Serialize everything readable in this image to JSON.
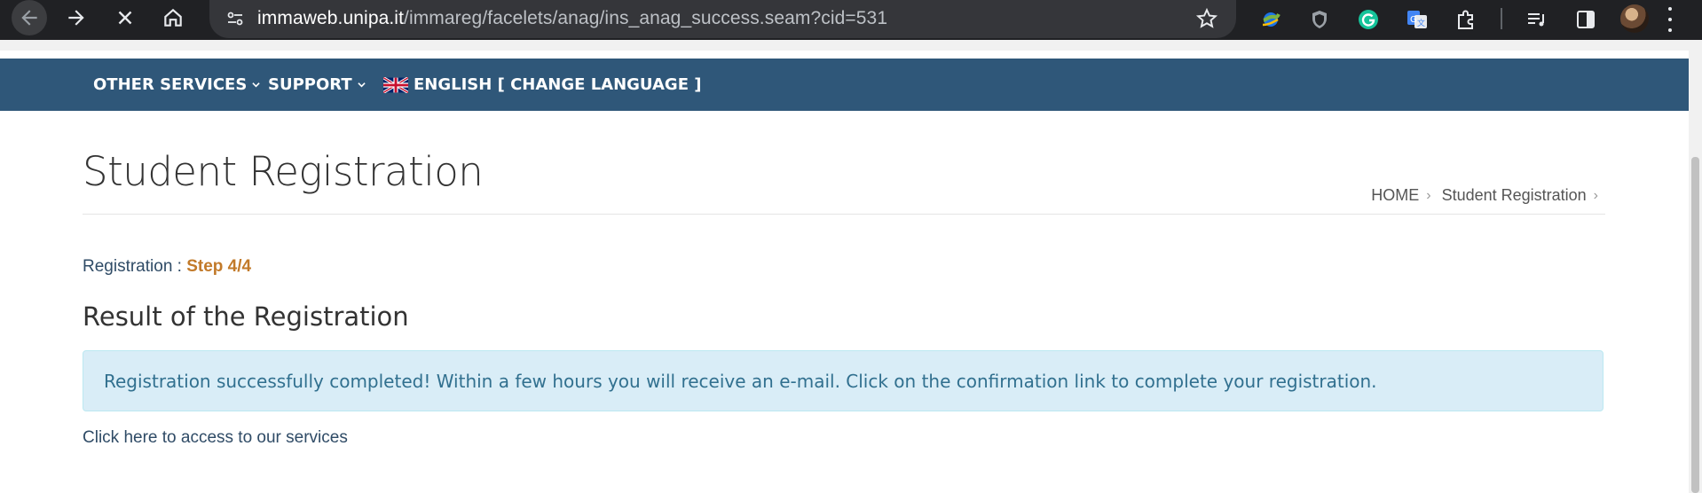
{
  "browser": {
    "url_host": "immaweb.unipa.it",
    "url_path": "/immareg/facelets/anag/ins_anag_success.seam?cid=531"
  },
  "nav": {
    "other_services": "OTHER SERVICES",
    "support": "SUPPORT",
    "language": "ENGLISH [ CHANGE LANGUAGE ]"
  },
  "page": {
    "title": "Student Registration",
    "breadcrumb": [
      "HOME",
      "Student Registration"
    ],
    "step_label": "Registration :",
    "step_value": "Step 4/4",
    "section_title": "Result of the Registration",
    "alert_text": "Registration successfully completed! Within a few hours you will receive an e-mail. Click on the confirmation link to complete your registration.",
    "services_link": "Click here to access to our services"
  },
  "colors": {
    "nav_bar": "#2f5779",
    "step_accent": "#c27a2a",
    "alert_bg": "#d9edf7",
    "alert_text": "#31708f"
  },
  "icons": [
    "back-arrow-icon",
    "forward-arrow-icon",
    "stop-icon",
    "home-icon",
    "site-info-icon",
    "bookmark-star-icon",
    "extension-icons",
    "profile-avatar",
    "menu-kebab-icon",
    "uk-flag-icon"
  ]
}
